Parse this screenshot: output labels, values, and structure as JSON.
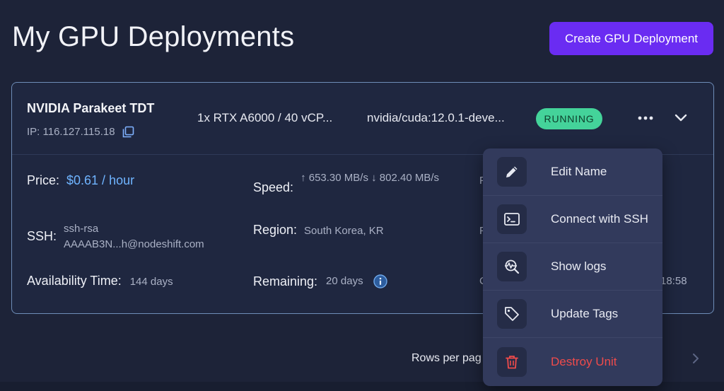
{
  "page": {
    "title": "My GPU Deployments",
    "create_button": "Create GPU Deployment"
  },
  "deployment": {
    "name": "NVIDIA Parakeet TDT",
    "ip": "IP: 116.127.115.18",
    "spec": "1x RTX A6000 / 40 vCP...",
    "image": "nvidia/cuda:12.0.1-deve...",
    "status": "RUNNING",
    "status_color": "#44d39a",
    "price_label": "Price:",
    "price_value": "$0.61 / hour",
    "speed_label": "Speed:",
    "speed_value": "↑ 653.30 MB/s ↓ 802.40 MB/s",
    "ssh_label": "SSH:",
    "ssh_value_line1": "ssh-rsa",
    "ssh_value_line2": "AAAAB3N...h@nodeshift.com",
    "region_label": "Region:",
    "region_value": "South Korea, KR",
    "availability_label": "Availability Time:",
    "availability_value": "144 days",
    "remaining_label": "Remaining:",
    "remaining_value": "20 days",
    "hidden_fragment_1": "F",
    "hidden_fragment_2": "F",
    "hidden_fragment_3": "C",
    "hidden_time_fragment": "18:58"
  },
  "menu": {
    "items": [
      {
        "label": "Edit Name",
        "icon": "pencil-icon"
      },
      {
        "label": "Connect with SSH",
        "icon": "terminal-icon"
      },
      {
        "label": "Show logs",
        "icon": "logs-search-icon"
      },
      {
        "label": "Update Tags",
        "icon": "tag-icon"
      },
      {
        "label": "Destroy Unit",
        "icon": "trash-icon",
        "color": "#ef4b4b"
      }
    ]
  },
  "pagination": {
    "rows_label": "Rows per pag"
  },
  "colors": {
    "accent": "#6a2cf2",
    "price": "#6fb4ff",
    "danger": "#ef4b4b"
  }
}
